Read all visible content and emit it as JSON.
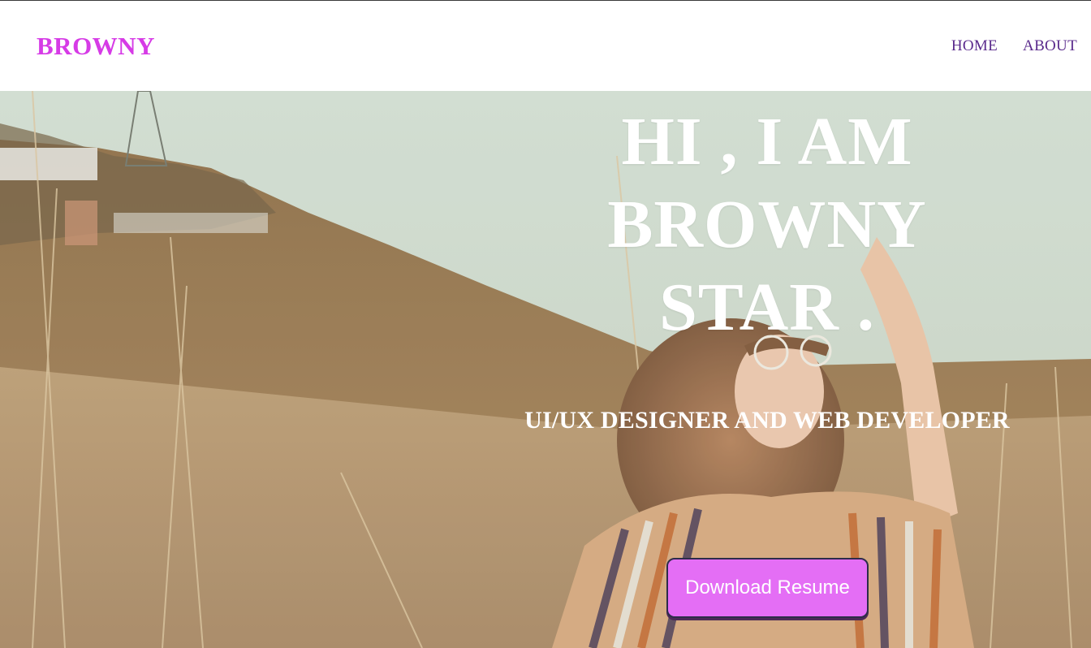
{
  "header": {
    "brand": "BROWNY",
    "nav": [
      {
        "label": "HOME"
      },
      {
        "label": "ABOUT"
      }
    ]
  },
  "hero": {
    "headline_lines": [
      "HI , I AM",
      "BROWNY",
      "STAR ."
    ],
    "subtitle": "UI/UX DESIGNER AND WEB DEVELOPER",
    "cta_label": "Download Resume"
  },
  "colors": {
    "brand": "#d63be6",
    "nav_text": "#5a2a8c",
    "cta_background": "#e46ef5",
    "hero_text": "#ffffff"
  }
}
